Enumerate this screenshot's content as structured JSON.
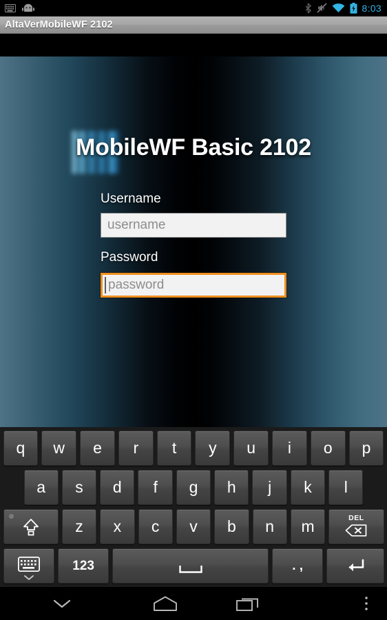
{
  "statusbar": {
    "left_icons": [
      "keyboard-icon",
      "android-robot-icon"
    ],
    "right_icons": [
      "bluetooth-icon",
      "volume-muted-icon",
      "wifi-icon",
      "battery-charging-icon"
    ],
    "time": "8:03"
  },
  "titlebar": {
    "title": "AltaVerMobileWF 2102"
  },
  "app": {
    "heading": "MobileWF Basic 2102",
    "username": {
      "label": "Username",
      "value": "",
      "placeholder": "username"
    },
    "password": {
      "label": "Password",
      "value": "",
      "placeholder": "password",
      "focused": true,
      "focus_color": "#ef8f1e"
    }
  },
  "keyboard": {
    "row1": [
      "q",
      "w",
      "e",
      "r",
      "t",
      "y",
      "u",
      "i",
      "o",
      "p"
    ],
    "row2": [
      "a",
      "s",
      "d",
      "f",
      "g",
      "h",
      "j",
      "k",
      "l"
    ],
    "row3_letters": [
      "z",
      "x",
      "c",
      "v",
      "b",
      "n",
      "m"
    ],
    "shift_key": "shift-icon",
    "delete_key": "DEL",
    "row4": {
      "switch_keyboard": "keyboard-switch-icon",
      "numbers": "123",
      "space": "space-icon",
      "punctuation": ". ,",
      "enter": "enter-icon"
    }
  },
  "navbar": {
    "back": "chevron-down-icon",
    "home": "home-icon",
    "recents": "recents-icon",
    "menu": "overflow-menu-icon"
  }
}
